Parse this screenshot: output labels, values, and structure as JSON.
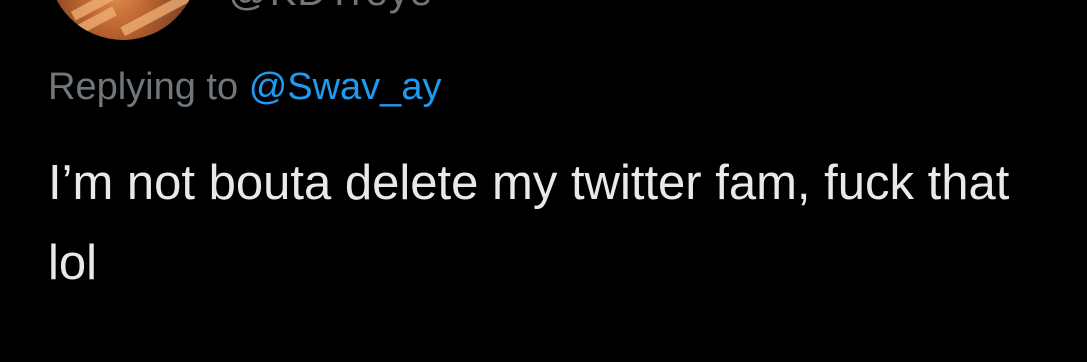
{
  "tweet": {
    "handle": "@KDTreye",
    "reply_prefix": "Replying to",
    "reply_mention": "@Swav_ay",
    "text": "I’m not bouta delete my twitter fam, fuck that lol"
  },
  "colors": {
    "background": "#000000",
    "muted": "#71767b",
    "mention": "#1d9bf0",
    "text": "#e7e9ea"
  },
  "icons": {
    "avatar": "profile-photo"
  }
}
